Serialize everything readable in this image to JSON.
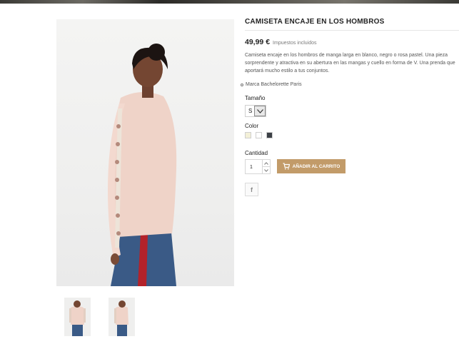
{
  "product": {
    "title": "CAMISETA ENCAJE EN LOS HOMBROS",
    "price": "49,99 €",
    "tax_note": "Impuestos incluidos",
    "description": "Camiseta encaje en los hombros de manga larga en blanco, negro o rosa pastel. Una pieza sorprendente y atractiva en su abertura en las mangas y cuello en forma de V. Una prenda que aportará mucho estilo a tus conjuntos.",
    "brand": "Marca Bachelorette Paris"
  },
  "options": {
    "size_label": "Tamaño",
    "size_value": "S",
    "color_label": "Color",
    "colors": [
      "#f3f0d8",
      "#ffffff",
      "#3c4046"
    ],
    "quantity_label": "Cantidad",
    "quantity_value": "1"
  },
  "actions": {
    "add_to_cart": "AÑADIR AL CARRITO",
    "facebook_share": "f"
  },
  "icons": {
    "cart": "cart-icon",
    "dropdown": "chevron-down-icon",
    "spin_up": "caret-up-icon",
    "spin_down": "caret-down-icon",
    "share": "facebook-icon"
  },
  "colors": {
    "accent_button": "#c29b69",
    "text_dark": "#232323"
  }
}
